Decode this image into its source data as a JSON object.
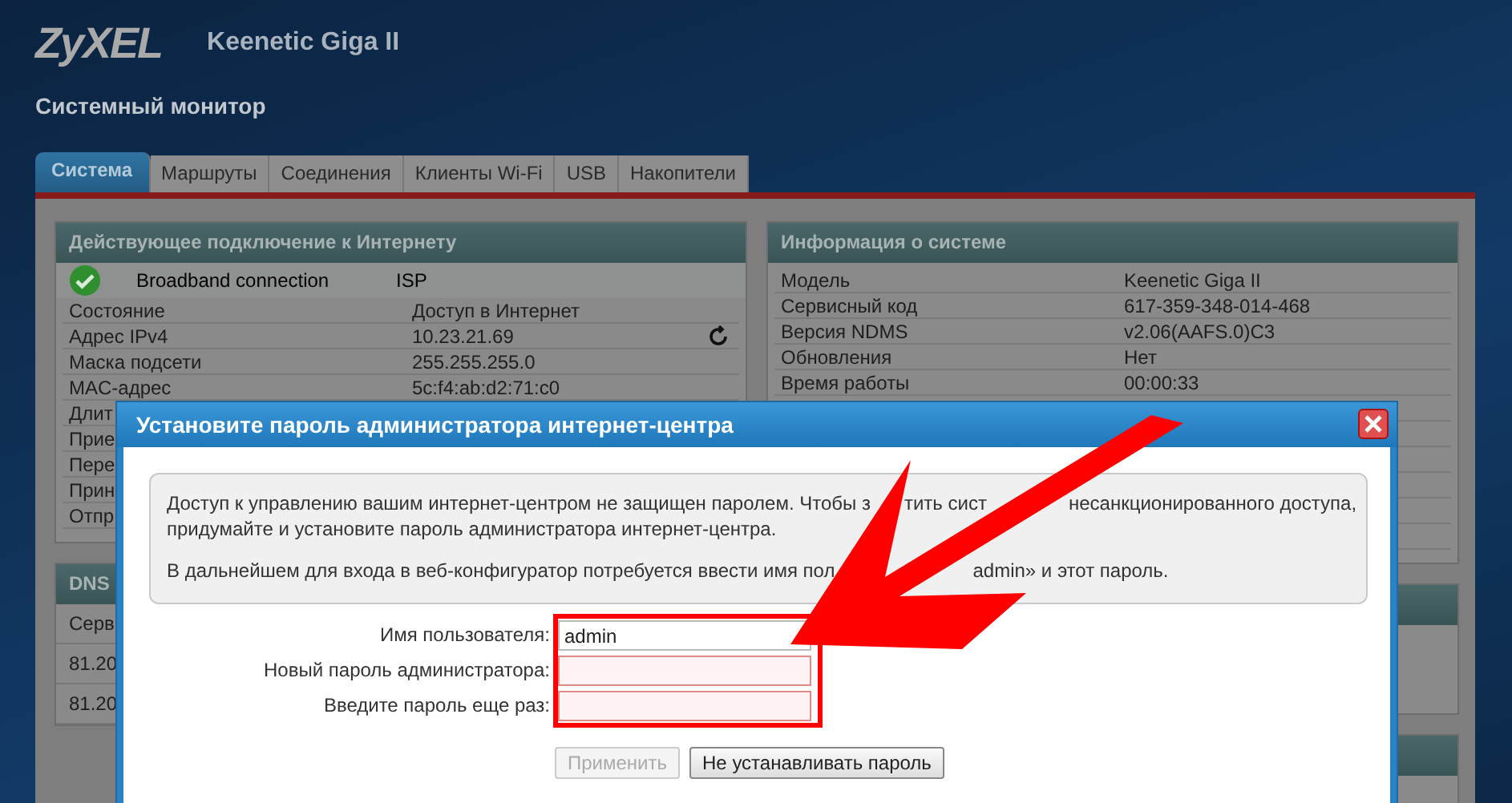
{
  "header": {
    "logo": "ZyXEL",
    "model": "Keenetic Giga II",
    "page_title": "Системный монитор"
  },
  "tabs": [
    {
      "label": "Система",
      "selected": true
    },
    {
      "label": "Маршруты",
      "selected": false
    },
    {
      "label": "Соединения",
      "selected": false
    },
    {
      "label": "Клиенты Wi-Fi",
      "selected": false
    },
    {
      "label": "USB",
      "selected": false
    },
    {
      "label": "Накопители",
      "selected": false
    }
  ],
  "internet_panel": {
    "title": "Действующее подключение к Интернету",
    "connection": {
      "name": "Broadband connection",
      "type": "ISP",
      "ok": true
    },
    "rows": [
      {
        "label": "Состояние",
        "value": "Доступ в Интернет"
      },
      {
        "label": "Адрес IPv4",
        "value": "10.23.21.69"
      },
      {
        "label": "Маска подсети",
        "value": "255.255.255.0"
      },
      {
        "label": "MAC-адрес",
        "value": "5c:f4:ab:d2:71:c0"
      },
      {
        "label": "Длит"
      },
      {
        "label": "Прие"
      },
      {
        "label": "Пере"
      },
      {
        "label": "Прин"
      },
      {
        "label": "Отпр"
      }
    ]
  },
  "dns_panel": {
    "title": "DNS",
    "column_1": "Серв",
    "rows": [
      "81.20",
      "81.20"
    ]
  },
  "system_panel": {
    "title": "Информация о системе",
    "rows": [
      {
        "label": "Модель",
        "value": "Keenetic Giga II"
      },
      {
        "label": "Сервисный код",
        "value": "617-359-348-014-468"
      },
      {
        "label": "Версия NDMS",
        "value": "v2.06(AAFS.0)C3"
      },
      {
        "label": "Обновления",
        "value": "Нет"
      },
      {
        "label": "Время работы",
        "value": "00:00:33"
      }
    ]
  },
  "dialog": {
    "title": "Установите пароль администратора интернет-центра",
    "paragraphs": [
      {
        "lines": [
          [
            "Доступ к управлению вашим интернет-центром не защищен паролем. Чтобы з",
            "тить сист",
            "несанкционированного доступа,"
          ],
          [
            "придумайте и установите пароль администратора интернет-центра."
          ]
        ]
      },
      {
        "lines": [
          [
            "В дальнейшем для входа в веб-конфигуратор потребуется ввести имя пол",
            "admin» и этот пароль."
          ]
        ]
      }
    ],
    "fields": [
      {
        "label": "Имя пользователя:",
        "value": "admin",
        "invalid": false
      },
      {
        "label": "Новый пароль администратора:",
        "invalid": true
      },
      {
        "label": "Введите пароль еще раз:",
        "invalid": true
      }
    ],
    "buttons": [
      {
        "label": "Применить",
        "disabled": true
      },
      {
        "label": "Не устанавливать пароль",
        "disabled": false
      }
    ]
  }
}
